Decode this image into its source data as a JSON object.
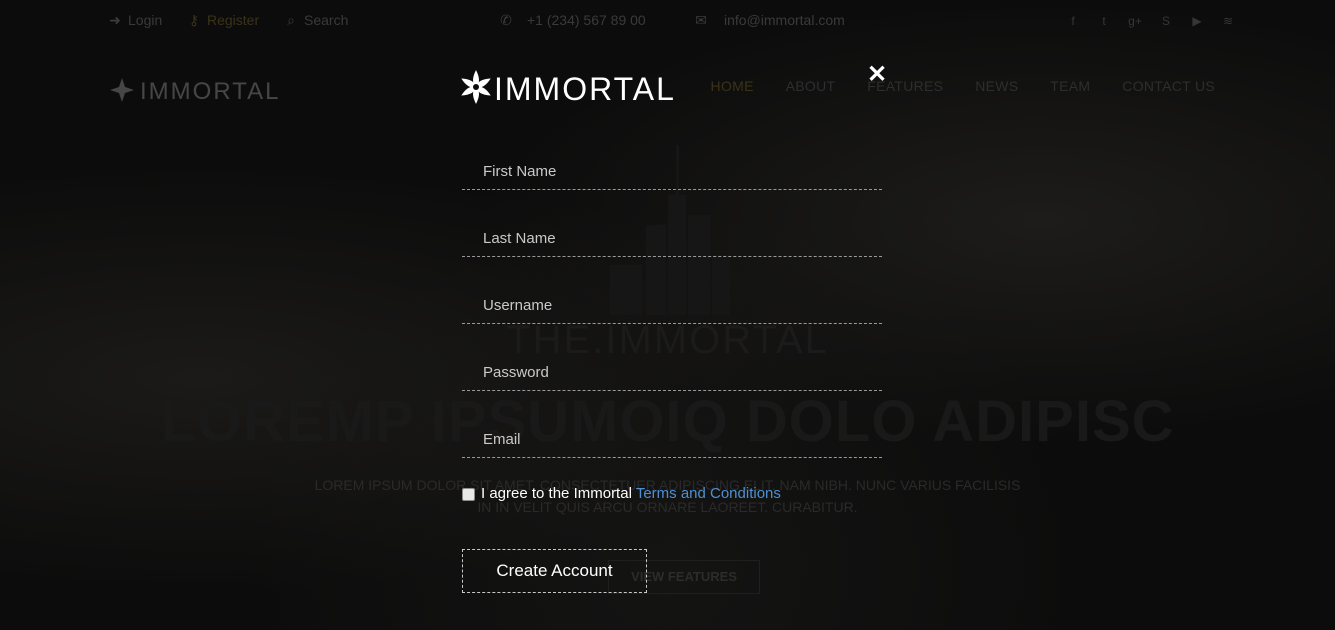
{
  "background": {
    "topbar": {
      "login": "Login",
      "register": "Register",
      "search": "Search",
      "phone": "+1 (234) 567 89 00",
      "email": "info@immortal.com",
      "social_icons": [
        "facebook-icon",
        "twitter-icon",
        "google-plus-icon",
        "skype-icon",
        "youtube-icon",
        "rss-icon"
      ]
    },
    "nav": {
      "items": [
        "HOME",
        "ABOUT",
        "FEATURES",
        "NEWS",
        "TEAM",
        "CONTACT US"
      ]
    },
    "hero": {
      "tagline": "THE.IMMORTAL",
      "headline": "LOREMP IPSUMOIQ DOLO ADIPISC",
      "subtitle_line1": "LOREM IPSUM DOLOR SIT AMET, CONSECTETUER ADIPISCING ELIT. NAM NIBH. NUNC VARIUS FACILISIS",
      "subtitle_line2": "IN IN VELIT QUIS ARCU ORNARE LAOREET. CURABITUR.",
      "button": "VIEW FEATURES"
    }
  },
  "modal": {
    "brand": "IMMORTAL",
    "close_symbol": "✕",
    "fields": {
      "first_name": {
        "placeholder": "First Name",
        "value": ""
      },
      "last_name": {
        "placeholder": "Last Name",
        "value": ""
      },
      "username": {
        "placeholder": "Username",
        "value": ""
      },
      "password": {
        "placeholder": "Password",
        "value": ""
      },
      "email": {
        "placeholder": "Email",
        "value": ""
      }
    },
    "agree": {
      "checked": false,
      "text": "I agree to the Immortal ",
      "link": "Terms and Conditions"
    },
    "submit_label": "Create Account"
  },
  "colors": {
    "overlay_background": "#0c0c0c",
    "text": "#ffffff",
    "placeholder": "#c9c9c9",
    "link": "#4f8fd1",
    "field_border": "#9a9a9a",
    "register_accent": "#3a3318"
  }
}
